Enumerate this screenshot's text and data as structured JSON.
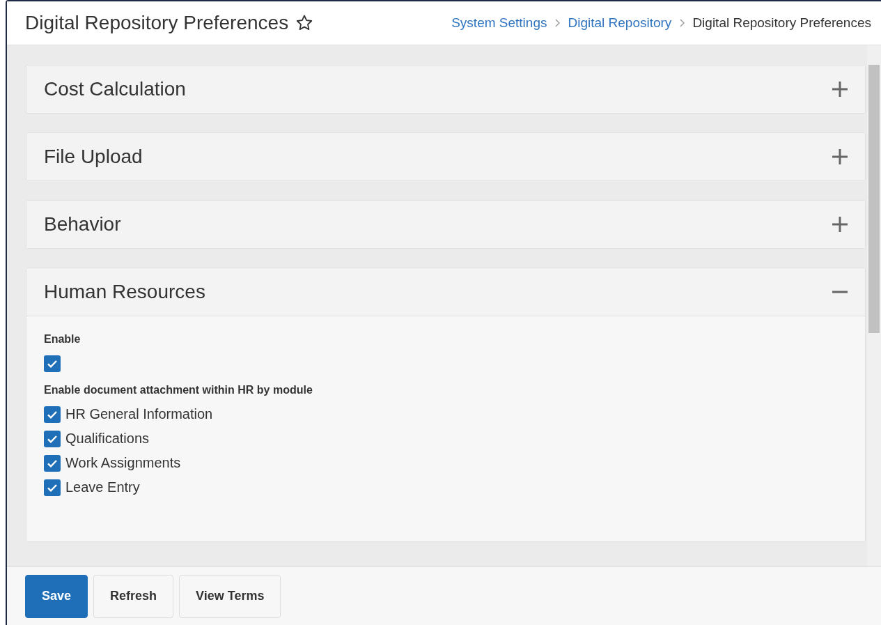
{
  "header": {
    "title": "Digital Repository Preferences",
    "favorite": false
  },
  "breadcrumbs": [
    {
      "label": "System Settings",
      "kind": "link"
    },
    {
      "label": "Digital Repository",
      "kind": "link"
    },
    {
      "label": "Digital Repository Preferences",
      "kind": "current"
    }
  ],
  "sections": [
    {
      "title": "Cost Calculation",
      "expanded": false
    },
    {
      "title": "File Upload",
      "expanded": false
    },
    {
      "title": "Behavior",
      "expanded": false
    },
    {
      "title": "Human Resources",
      "expanded": true,
      "groups": [
        {
          "label": "Enable",
          "options": [
            {
              "checked": true
            }
          ]
        },
        {
          "label": "Enable document attachment within HR by module",
          "options": [
            {
              "label": "HR General Information",
              "checked": true
            },
            {
              "label": "Qualifications",
              "checked": true
            },
            {
              "label": "Work Assignments",
              "checked": true
            },
            {
              "label": "Leave Entry",
              "checked": true
            }
          ]
        }
      ]
    }
  ],
  "buttons": [
    {
      "label": "Save",
      "kind": "primary"
    },
    {
      "label": "Refresh",
      "kind": "secondary"
    },
    {
      "label": "View Terms",
      "kind": "secondary"
    }
  ]
}
